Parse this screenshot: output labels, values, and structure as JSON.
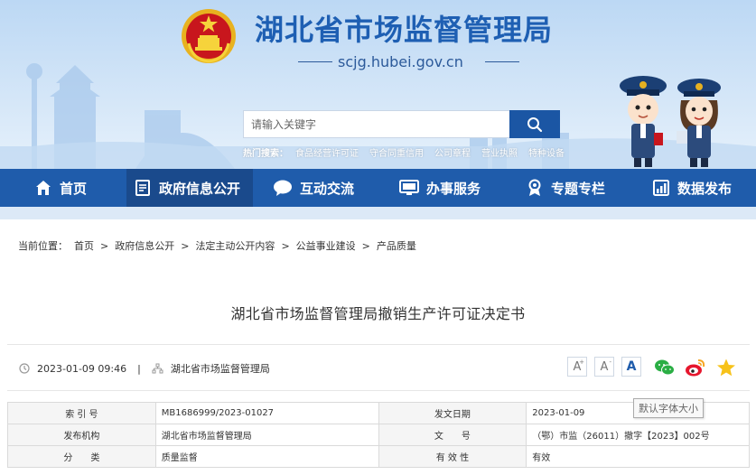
{
  "header": {
    "site_title": "湖北省市场监督管理局",
    "domain": "scjg.hubei.gov.cn",
    "search_placeholder": "请输入关键字",
    "hot_label": "热门搜索：",
    "hot_words": [
      "食品经营许可证",
      "守合同重信用",
      "公司章程",
      "营业执照",
      "特种设备"
    ]
  },
  "nav": {
    "items": [
      {
        "label": "首页",
        "icon": "home-icon"
      },
      {
        "label": "政府信息公开",
        "icon": "document-icon"
      },
      {
        "label": "互动交流",
        "icon": "chat-icon"
      },
      {
        "label": "办事服务",
        "icon": "monitor-icon"
      },
      {
        "label": "专题专栏",
        "icon": "medal-icon"
      },
      {
        "label": "数据发布",
        "icon": "chart-icon"
      }
    ]
  },
  "breadcrumb": {
    "label": "当前位置：",
    "items": [
      "首页",
      "政府信息公开",
      "法定主动公开内容",
      "公益事业建设",
      "产品质量"
    ],
    "separator": ">"
  },
  "article": {
    "title": "湖北省市场监督管理局撤销生产许可证决定书",
    "datetime": "2023-01-09 09:46",
    "separator": "|",
    "source": "湖北省市场监督管理局"
  },
  "font_controls": {
    "increase": "A",
    "decrease": "A",
    "default": "A",
    "tooltip": "默认字体大小"
  },
  "share": [
    "wechat-icon",
    "weibo-icon",
    "favorite-star-icon"
  ],
  "info_table": {
    "rows": [
      [
        {
          "k": "索 引 号",
          "v": "MB1686999/2023-01027"
        },
        {
          "k": "发文日期",
          "v": "2023-01-09"
        }
      ],
      [
        {
          "k": "发布机构",
          "v": "湖北省市场监督管理局"
        },
        {
          "k": "文　　号",
          "v": "（鄂）市监（26011）撤字【2023】002号"
        }
      ],
      [
        {
          "k": "分　　类",
          "v": "质量监督"
        },
        {
          "k": "有 效 性",
          "v": "有效"
        }
      ]
    ]
  },
  "colors": {
    "brand_blue": "#1f5cab",
    "title_blue": "#1e5fb3",
    "nav_active": "#1a4a8c"
  }
}
